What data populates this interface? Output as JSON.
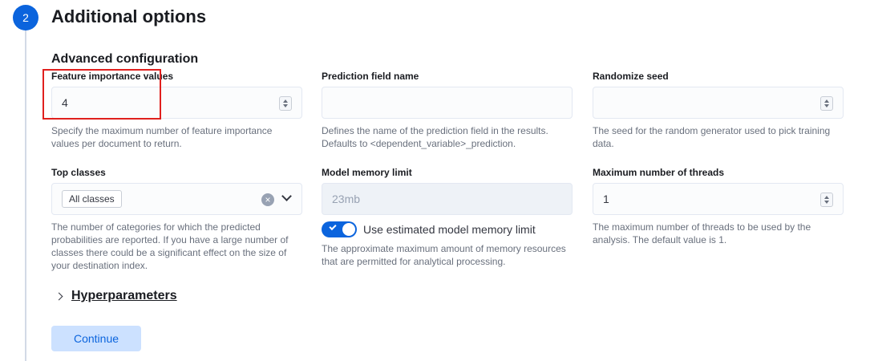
{
  "step": {
    "number": "2",
    "title": "Additional options"
  },
  "section": {
    "title": "Advanced configuration"
  },
  "fields": {
    "feature_importance": {
      "label": "Feature importance values",
      "value": "4",
      "help": "Specify the maximum number of feature importance values per document to return."
    },
    "prediction_field": {
      "label": "Prediction field name",
      "value": "",
      "help": "Defines the name of the prediction field in the results. Defaults to <dependent_variable>_prediction."
    },
    "randomize_seed": {
      "label": "Randomize seed",
      "value": "",
      "help": "The seed for the random generator used to pick training data."
    },
    "top_classes": {
      "label": "Top classes",
      "selected": "All classes",
      "help": "The number of categories for which the predicted probabilities are reported. If you have a large number of classes there could be a significant effect on the size of your destination index."
    },
    "model_memory": {
      "label": "Model memory limit",
      "value": "23mb",
      "toggle_label": "Use estimated model memory limit",
      "toggle_on": true,
      "help": "The approximate maximum amount of memory resources that are permitted for analytical processing."
    },
    "max_threads": {
      "label": "Maximum number of threads",
      "value": "1",
      "help": "The maximum number of threads to be used by the analysis. The default value is 1."
    }
  },
  "hyperparameters": {
    "label": "Hyperparameters"
  },
  "continue_button": {
    "label": "Continue"
  },
  "colors": {
    "accent": "#0b64dd",
    "highlight": "#e0201e"
  }
}
